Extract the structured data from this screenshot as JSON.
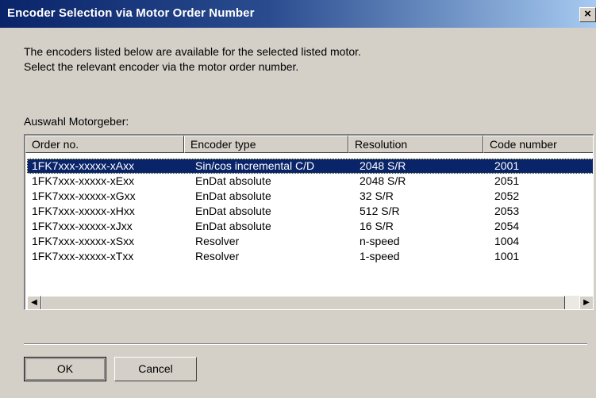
{
  "window": {
    "title": "Encoder Selection via Motor Order Number",
    "close_glyph": "×"
  },
  "intro": {
    "line1": "The encoders listed below are available for the selected listed motor.",
    "line2": "Select the relevant encoder via the motor order number."
  },
  "group_label": "Auswahl Motorgeber:",
  "table": {
    "columns": [
      "Order no.",
      "Encoder type",
      "Resolution",
      "Code number"
    ],
    "selected_row": 0,
    "rows": [
      [
        "1FK7xxx-xxxxx-xAxx",
        "Sin/cos incremental C/D",
        "2048 S/R",
        "2001"
      ],
      [
        "1FK7xxx-xxxxx-xExx",
        "EnDat absolute",
        "2048 S/R",
        "2051"
      ],
      [
        "1FK7xxx-xxxxx-xGxx",
        "EnDat absolute",
        "32 S/R",
        "2052"
      ],
      [
        "1FK7xxx-xxxxx-xHxx",
        "EnDat absolute",
        "512 S/R",
        "2053"
      ],
      [
        "1FK7xxx-xxxxx-xJxx",
        "EnDat absolute",
        "16 S/R",
        "2054"
      ],
      [
        "1FK7xxx-xxxxx-xSxx",
        "Resolver",
        "n-speed",
        "1004"
      ],
      [
        "1FK7xxx-xxxxx-xTxx",
        "Resolver",
        "1-speed",
        "1001"
      ]
    ]
  },
  "scrollbar": {
    "left_arrow": "◀",
    "right_arrow": "▶"
  },
  "buttons": {
    "ok": "OK",
    "cancel": "Cancel"
  }
}
